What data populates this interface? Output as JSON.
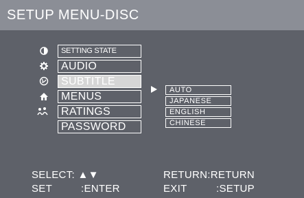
{
  "title": "SETUP MENU-DISC",
  "menu": {
    "items": [
      {
        "label": "SETTING STATE",
        "icon": "contrast-circle-icon"
      },
      {
        "label": "AUDIO",
        "icon": "gear-icon"
      },
      {
        "label": "SUBTITLE",
        "icon": "globe-icon"
      },
      {
        "label": "MENUS",
        "icon": "house-icon"
      },
      {
        "label": "RATINGS",
        "icon": "people-icon"
      },
      {
        "label": "PASSWORD",
        "icon": ""
      }
    ],
    "selected": "SUBTITLE"
  },
  "submenu": {
    "options": [
      "AUTO",
      "JAPANESE",
      "ENGLISH",
      "CHINESE"
    ]
  },
  "footer": {
    "select_label": "SELECT:",
    "select_arrows": "▲▼",
    "return_label": "RETURN:RETURN",
    "set_label": "SET",
    "set_value": ":ENTER",
    "exit_label": "EXIT",
    "exit_value": ":SETUP"
  },
  "colors": {
    "background": "#5e6169",
    "title_bar": "#8b8e96",
    "selected_item": "#d6d6d6",
    "text": "#ffffff"
  }
}
